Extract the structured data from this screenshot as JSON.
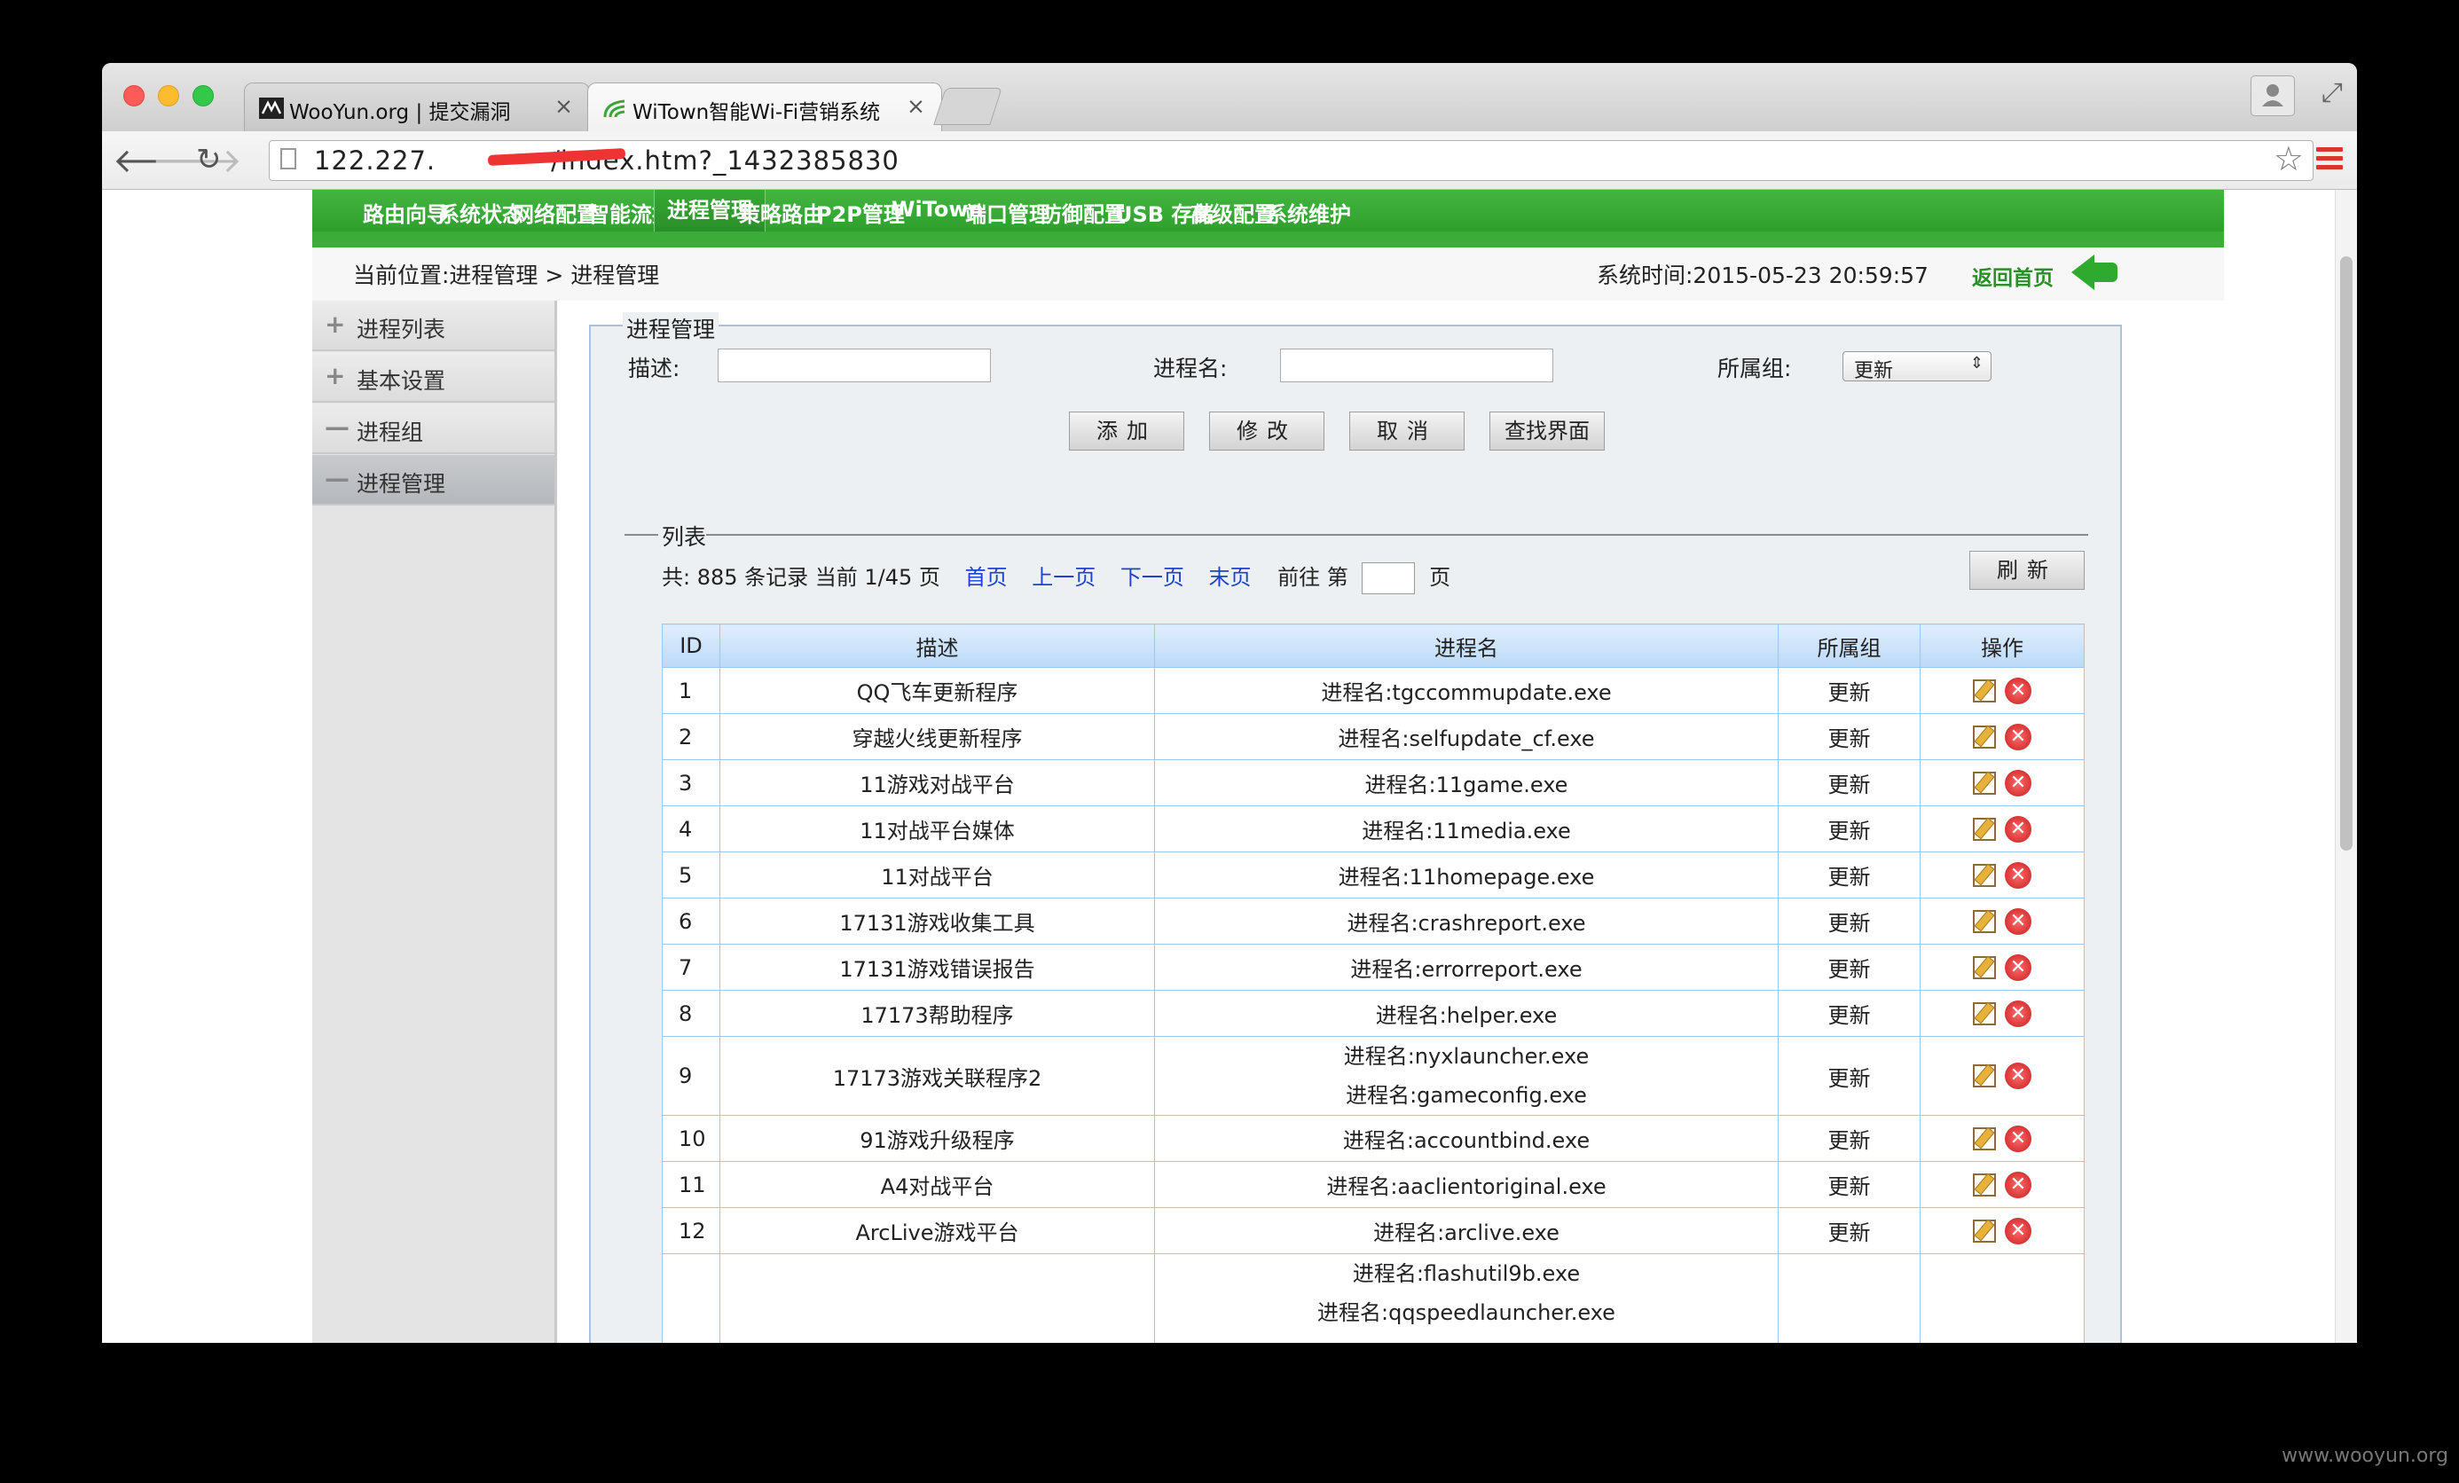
{
  "browser": {
    "tabs": [
      {
        "title": "WooYun.org | 提交漏洞",
        "active": false
      },
      {
        "title": "WiTown智能Wi-Fi营销系统",
        "active": true
      }
    ],
    "close_glyph": "×",
    "url_visible_prefix": "122.227.",
    "url_visible_suffix": "/index.htm?_1432385830",
    "icons": [
      "back-icon",
      "forward-icon",
      "reload-icon",
      "page-icon",
      "bookmark-star-icon",
      "menu-icon",
      "profile-icon",
      "expand-icon"
    ]
  },
  "nav": {
    "items": [
      "路由向导",
      "系统状态",
      "网络配置",
      "智能流控",
      "进程管理",
      "策略路由",
      "P2P管理",
      "WiTown",
      "端口管理",
      "防御配置",
      "USB 存储",
      "高级配置",
      "系统维护"
    ],
    "active_index": 4,
    "color": "#36a934"
  },
  "crumb": {
    "location": "当前位置:进程管理 > 进程管理",
    "system_time": "系统时间:2015-05-23 20:59:57",
    "home_link": "返回首页"
  },
  "sidebar": {
    "items": [
      {
        "sign": "+",
        "label": "进程列表"
      },
      {
        "sign": "+",
        "label": "基本设置"
      },
      {
        "sign": "—",
        "label": "进程组"
      },
      {
        "sign": "—",
        "label": "进程管理"
      }
    ]
  },
  "form": {
    "legend": "进程管理",
    "desc_label": "描述:",
    "desc_value": "",
    "name_label": "进程名:",
    "name_value": "",
    "group_label": "所属组:",
    "group_selected": "更新",
    "buttons": {
      "add": "添加",
      "modify": "修改",
      "cancel": "取消",
      "search": "查找界面"
    }
  },
  "list": {
    "legend": "列表",
    "pager": {
      "summary": "共: 885 条记录 当前 1/45 页",
      "first": "首页",
      "prev": "上一页",
      "next": "下一页",
      "last": "末页",
      "goto_prefix": "前往 第",
      "goto_suffix": "页"
    },
    "refresh": "刷新",
    "columns": [
      "ID",
      "描述",
      "进程名",
      "所属组",
      "操作"
    ],
    "rows": [
      {
        "id": "1",
        "desc": "QQ飞车更新程序",
        "procs": [
          "进程名:tgccommupdate.exe"
        ],
        "group": "更新"
      },
      {
        "id": "2",
        "desc": "穿越火线更新程序",
        "procs": [
          "进程名:selfupdate_cf.exe"
        ],
        "group": "更新"
      },
      {
        "id": "3",
        "desc": "11游戏对战平台",
        "procs": [
          "进程名:11game.exe"
        ],
        "group": "更新"
      },
      {
        "id": "4",
        "desc": "11对战平台媒体",
        "procs": [
          "进程名:11media.exe"
        ],
        "group": "更新"
      },
      {
        "id": "5",
        "desc": "11对战平台",
        "procs": [
          "进程名:11homepage.exe"
        ],
        "group": "更新"
      },
      {
        "id": "6",
        "desc": "17131游戏收集工具",
        "procs": [
          "进程名:crashreport.exe"
        ],
        "group": "更新"
      },
      {
        "id": "7",
        "desc": "17131游戏错误报告",
        "procs": [
          "进程名:errorreport.exe"
        ],
        "group": "更新"
      },
      {
        "id": "8",
        "desc": "17173帮助程序",
        "procs": [
          "进程名:helper.exe"
        ],
        "group": "更新"
      },
      {
        "id": "9",
        "desc": "17173游戏关联程序2",
        "procs": [
          "进程名:nyxlauncher.exe",
          "进程名:gameconfig.exe"
        ],
        "group": "更新"
      },
      {
        "id": "10",
        "desc": "91游戏升级程序",
        "procs": [
          "进程名:accountbind.exe"
        ],
        "group": "更新"
      },
      {
        "id": "11",
        "desc": "A4对战平台",
        "procs": [
          "进程名:aaclientoriginal.exe"
        ],
        "group": "更新"
      },
      {
        "id": "12",
        "desc": "ArcLive游戏平台",
        "procs": [
          "进程名:arclive.exe"
        ],
        "group": "更新"
      }
    ],
    "partial_row_procs": [
      "进程名:flashutil9b.exe",
      "进程名:qqspeedlauncher.exe"
    ]
  },
  "watermark": "www.wooyun.org"
}
